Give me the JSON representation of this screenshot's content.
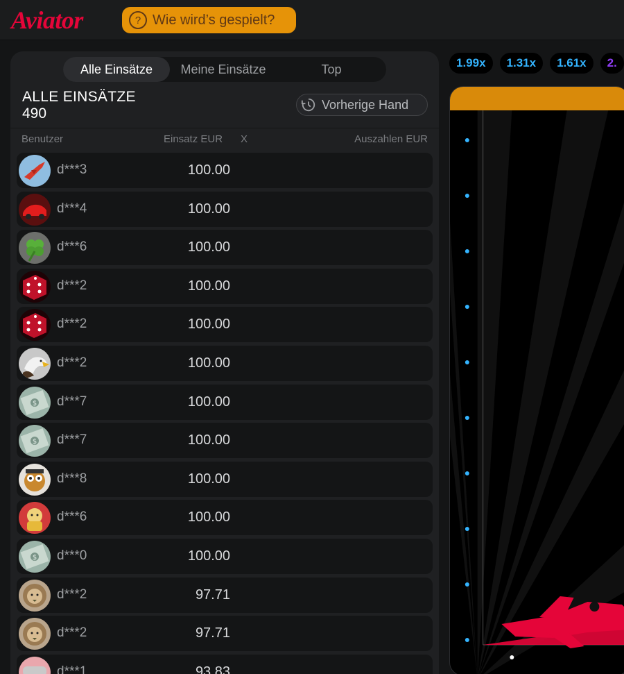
{
  "header": {
    "logo_text": "Aviator",
    "howto_label": "Wie wird’s gespielt?",
    "howto_icon": "?"
  },
  "panel": {
    "tabs": [
      {
        "label": "Alle Einsätze",
        "active": true
      },
      {
        "label": "Meine Einsätze",
        "active": false
      },
      {
        "label": "Top",
        "active": false
      }
    ],
    "title": "ALLE EINSÄTZE",
    "count": "490",
    "prev_hand_label": "Vorherige Hand",
    "columns": {
      "user": "Benutzer",
      "bet": "Einsatz EUR",
      "x": "X",
      "payout": "Auszahlen EUR"
    },
    "rows": [
      {
        "user": "d***3",
        "bet": "100.00",
        "avatar": "jet"
      },
      {
        "user": "d***4",
        "bet": "100.00",
        "avatar": "red-car"
      },
      {
        "user": "d***6",
        "bet": "100.00",
        "avatar": "clover"
      },
      {
        "user": "d***2",
        "bet": "100.00",
        "avatar": "dice"
      },
      {
        "user": "d***2",
        "bet": "100.00",
        "avatar": "dice"
      },
      {
        "user": "d***2",
        "bet": "100.00",
        "avatar": "eagle"
      },
      {
        "user": "d***7",
        "bet": "100.00",
        "avatar": "dollar"
      },
      {
        "user": "d***7",
        "bet": "100.00",
        "avatar": "dollar"
      },
      {
        "user": "d***8",
        "bet": "100.00",
        "avatar": "dog"
      },
      {
        "user": "d***6",
        "bet": "100.00",
        "avatar": "lucky-cat"
      },
      {
        "user": "d***0",
        "bet": "100.00",
        "avatar": "dollar"
      },
      {
        "user": "d***2",
        "bet": "97.71",
        "avatar": "lion"
      },
      {
        "user": "d***2",
        "bet": "97.71",
        "avatar": "lion"
      },
      {
        "user": "d***1",
        "bet": "93.83",
        "avatar": "car-pink"
      }
    ]
  },
  "multipliers": [
    {
      "value": "1.99x",
      "color": "#34b4ff"
    },
    {
      "value": "1.31x",
      "color": "#34b4ff"
    },
    {
      "value": "1.61x",
      "color": "#34b4ff"
    },
    {
      "value": "2.",
      "color": "#913ef8"
    }
  ],
  "colors": {
    "brand": "#e50539",
    "accent": "#e69308",
    "blue_mult": "#34b4ff",
    "purple_mult": "#913ef8"
  }
}
